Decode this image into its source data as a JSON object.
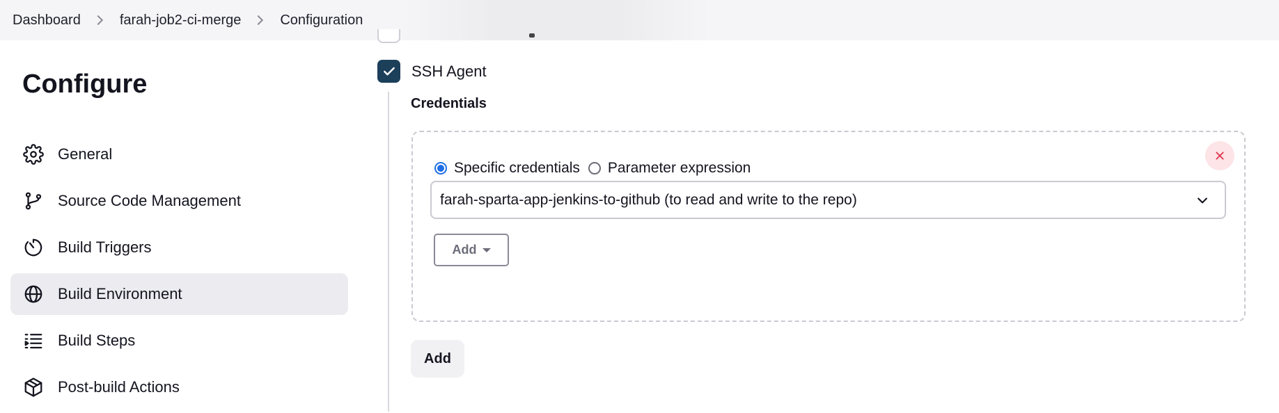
{
  "breadcrumb": {
    "items": [
      "Dashboard",
      "farah-job2-ci-merge",
      "Configuration"
    ]
  },
  "sidebar": {
    "title": "Configure",
    "items": [
      {
        "label": "General",
        "icon": "gear-icon"
      },
      {
        "label": "Source Code Management",
        "icon": "branch-icon"
      },
      {
        "label": "Build Triggers",
        "icon": "timer-icon"
      },
      {
        "label": "Build Environment",
        "icon": "globe-icon",
        "active": true
      },
      {
        "label": "Build Steps",
        "icon": "list-icon"
      },
      {
        "label": "Post-build Actions",
        "icon": "package-icon"
      }
    ]
  },
  "main": {
    "ssh_agent": {
      "label": "SSH Agent",
      "checked": true
    },
    "credentials": {
      "label": "Credentials",
      "mode_options": [
        {
          "label": "Specific credentials",
          "selected": true
        },
        {
          "label": "Parameter expression",
          "selected": false
        }
      ],
      "selected_value": "farah-sparta-app-jenkins-to-github (to read and write to the repo)",
      "add_dropdown_label": "Add"
    },
    "add_button_label": "Add"
  },
  "colors": {
    "checkbox": "#1c3f5a",
    "radio_selected": "#1e6fe6",
    "remove_x": "#e0304a",
    "active_nav_bg": "#ececf0"
  }
}
